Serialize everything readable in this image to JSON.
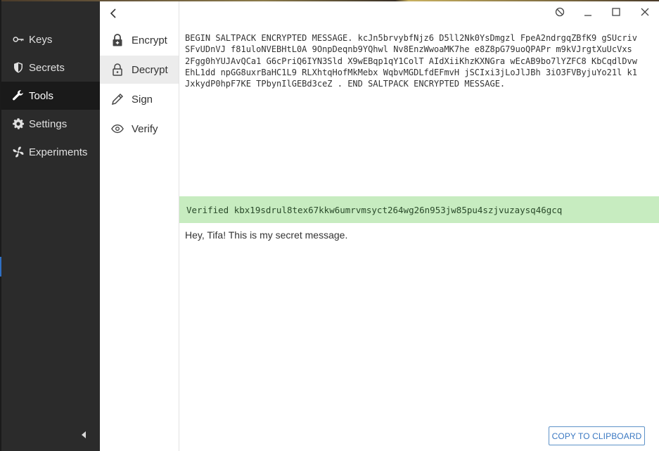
{
  "sidebar": {
    "items": [
      {
        "label": "Keys",
        "icon": "key-icon"
      },
      {
        "label": "Secrets",
        "icon": "shield-icon"
      },
      {
        "label": "Tools",
        "icon": "wrench-icon"
      },
      {
        "label": "Settings",
        "icon": "gear-icon"
      },
      {
        "label": "Experiments",
        "icon": "fan-icon"
      }
    ],
    "active": "Tools"
  },
  "tools_nav": {
    "items": [
      {
        "label": "Encrypt",
        "icon": "lock-plus-icon"
      },
      {
        "label": "Decrypt",
        "icon": "unlock-icon"
      },
      {
        "label": "Sign",
        "icon": "pencil-icon"
      },
      {
        "label": "Verify",
        "icon": "eye-icon"
      }
    ],
    "active": "Decrypt"
  },
  "input": {
    "text": "BEGIN SALTPACK ENCRYPTED MESSAGE. kcJn5brvybfNjz6 D5ll2Nk0YsDmgzl FpeA2ndrgqZBfK9 gSUcrivSFvUDnVJ f81uloNVEBHtL0A 9OnpDeqnb9YQhwl Nv8EnzWwoaMK7he e8Z8pG79uoQPAPr m9kVJrgtXuUcVxs 2Fgg0hYUJAvQCa1 G6cPriQ6IYN3Sld X9wEBqp1qY1ColT AIdXiiKhzKXNGra wEcAB9bo7lYZFC8 KbCqdlDvwEhL1dd npGG8uxrBaHC1L9 RLXhtqHofMkMebx WqbvMGDLfdEFmvH jSCIxi3jLoJlJBh 3iO3FVByjuYo21l k1JxkydP0hpF7KE TPbynIlGEBd3ceZ . END SALTPACK ENCRYPTED MESSAGE."
  },
  "verification": {
    "text": "Verified kbx19sdrul8tex67kkw6umrvmsyct264wg26n953jw85pu4szjvuzaysq46gcq",
    "color": "#c7ecc0"
  },
  "output": {
    "text": "Hey, Tifa! This is my secret message."
  },
  "actions": {
    "copy_label": "COPY TO CLIPBOARD"
  },
  "colors": {
    "sidebar_bg": "#2b2b2b",
    "accent": "#3a78c2"
  }
}
